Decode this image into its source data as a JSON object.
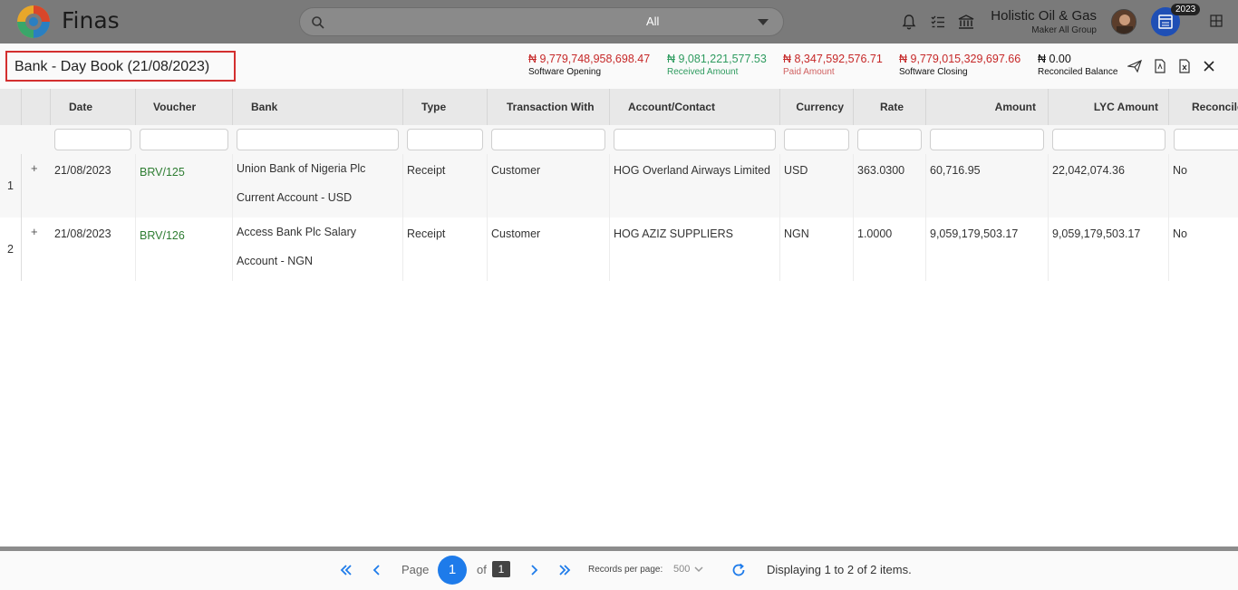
{
  "app": {
    "brand": "Finas"
  },
  "search": {
    "value": "",
    "scope": "All"
  },
  "company": {
    "name": "Holistic Oil & Gas",
    "group": "Maker All Group"
  },
  "year_badge": "2023",
  "page": {
    "title": "Bank - Day Book (21/08/2023)"
  },
  "stats": [
    {
      "value": "₦ 9,779,748,958,698.47",
      "label": "Software Opening"
    },
    {
      "value": "₦ 9,081,221,577.53",
      "label": "Received Amount"
    },
    {
      "value": "₦ 8,347,592,576.71",
      "label": "Paid Amount"
    },
    {
      "value": "₦ 9,779,015,329,697.66",
      "label": "Software Closing"
    },
    {
      "value": "₦ 0.00",
      "label": "Reconciled Balance"
    }
  ],
  "colors": {
    "accent": "#1e7bea",
    "negative": "#c62828",
    "positive": "#2e9b5f",
    "voucher": "#2e7d32",
    "highlight_border": "#d32f2f"
  },
  "table": {
    "columns": [
      "Date",
      "Voucher",
      "Bank",
      "Type",
      "Transaction With",
      "Account/Contact",
      "Currency",
      "Rate",
      "Amount",
      "LYC Amount",
      "Reconcile"
    ],
    "rows": [
      {
        "num": "1",
        "expand": "+",
        "date": "21/08/2023",
        "voucher": "BRV/125",
        "bank1": "Union Bank of Nigeria Plc",
        "bank2": "Current Account - USD",
        "type": "Receipt",
        "with": "Customer",
        "account": "HOG Overland Airways Limited",
        "currency": "USD",
        "rate": "363.0300",
        "amount": "60,716.95",
        "lyc": "22,042,074.36",
        "reconcile": "No"
      },
      {
        "num": "2",
        "expand": "+",
        "date": "21/08/2023",
        "voucher": "BRV/126",
        "bank1": "Access Bank Plc Salary",
        "bank2": "Account - NGN",
        "type": "Receipt",
        "with": "Customer",
        "account": "HOG AZIZ SUPPLIERS",
        "currency": "NGN",
        "rate": "1.0000",
        "amount": "9,059,179,503.17",
        "lyc": "9,059,179,503.17",
        "reconcile": "No"
      }
    ]
  },
  "pager": {
    "page_label": "Page",
    "current": "1",
    "of_label": "of",
    "total": "1",
    "records_label": "Records per page:",
    "records_value": "500",
    "display": "Displaying 1 to 2 of 2 items."
  }
}
